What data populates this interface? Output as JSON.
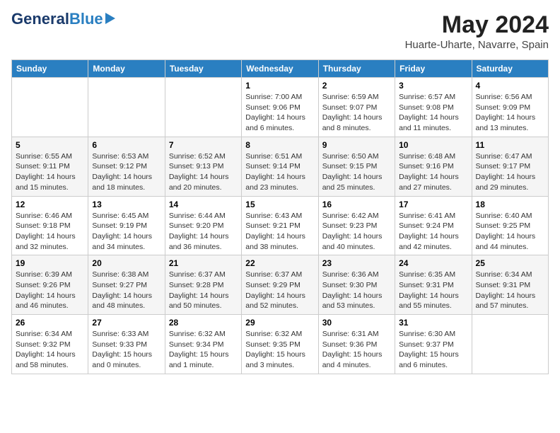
{
  "logo": {
    "general": "General",
    "blue": "Blue"
  },
  "title": {
    "month_year": "May 2024",
    "location": "Huarte-Uharte, Navarre, Spain"
  },
  "headers": [
    "Sunday",
    "Monday",
    "Tuesday",
    "Wednesday",
    "Thursday",
    "Friday",
    "Saturday"
  ],
  "weeks": [
    [
      {
        "day": "",
        "info": ""
      },
      {
        "day": "",
        "info": ""
      },
      {
        "day": "",
        "info": ""
      },
      {
        "day": "1",
        "info": "Sunrise: 7:00 AM\nSunset: 9:06 PM\nDaylight: 14 hours\nand 6 minutes."
      },
      {
        "day": "2",
        "info": "Sunrise: 6:59 AM\nSunset: 9:07 PM\nDaylight: 14 hours\nand 8 minutes."
      },
      {
        "day": "3",
        "info": "Sunrise: 6:57 AM\nSunset: 9:08 PM\nDaylight: 14 hours\nand 11 minutes."
      },
      {
        "day": "4",
        "info": "Sunrise: 6:56 AM\nSunset: 9:09 PM\nDaylight: 14 hours\nand 13 minutes."
      }
    ],
    [
      {
        "day": "5",
        "info": "Sunrise: 6:55 AM\nSunset: 9:11 PM\nDaylight: 14 hours\nand 15 minutes."
      },
      {
        "day": "6",
        "info": "Sunrise: 6:53 AM\nSunset: 9:12 PM\nDaylight: 14 hours\nand 18 minutes."
      },
      {
        "day": "7",
        "info": "Sunrise: 6:52 AM\nSunset: 9:13 PM\nDaylight: 14 hours\nand 20 minutes."
      },
      {
        "day": "8",
        "info": "Sunrise: 6:51 AM\nSunset: 9:14 PM\nDaylight: 14 hours\nand 23 minutes."
      },
      {
        "day": "9",
        "info": "Sunrise: 6:50 AM\nSunset: 9:15 PM\nDaylight: 14 hours\nand 25 minutes."
      },
      {
        "day": "10",
        "info": "Sunrise: 6:48 AM\nSunset: 9:16 PM\nDaylight: 14 hours\nand 27 minutes."
      },
      {
        "day": "11",
        "info": "Sunrise: 6:47 AM\nSunset: 9:17 PM\nDaylight: 14 hours\nand 29 minutes."
      }
    ],
    [
      {
        "day": "12",
        "info": "Sunrise: 6:46 AM\nSunset: 9:18 PM\nDaylight: 14 hours\nand 32 minutes."
      },
      {
        "day": "13",
        "info": "Sunrise: 6:45 AM\nSunset: 9:19 PM\nDaylight: 14 hours\nand 34 minutes."
      },
      {
        "day": "14",
        "info": "Sunrise: 6:44 AM\nSunset: 9:20 PM\nDaylight: 14 hours\nand 36 minutes."
      },
      {
        "day": "15",
        "info": "Sunrise: 6:43 AM\nSunset: 9:21 PM\nDaylight: 14 hours\nand 38 minutes."
      },
      {
        "day": "16",
        "info": "Sunrise: 6:42 AM\nSunset: 9:23 PM\nDaylight: 14 hours\nand 40 minutes."
      },
      {
        "day": "17",
        "info": "Sunrise: 6:41 AM\nSunset: 9:24 PM\nDaylight: 14 hours\nand 42 minutes."
      },
      {
        "day": "18",
        "info": "Sunrise: 6:40 AM\nSunset: 9:25 PM\nDaylight: 14 hours\nand 44 minutes."
      }
    ],
    [
      {
        "day": "19",
        "info": "Sunrise: 6:39 AM\nSunset: 9:26 PM\nDaylight: 14 hours\nand 46 minutes."
      },
      {
        "day": "20",
        "info": "Sunrise: 6:38 AM\nSunset: 9:27 PM\nDaylight: 14 hours\nand 48 minutes."
      },
      {
        "day": "21",
        "info": "Sunrise: 6:37 AM\nSunset: 9:28 PM\nDaylight: 14 hours\nand 50 minutes."
      },
      {
        "day": "22",
        "info": "Sunrise: 6:37 AM\nSunset: 9:29 PM\nDaylight: 14 hours\nand 52 minutes."
      },
      {
        "day": "23",
        "info": "Sunrise: 6:36 AM\nSunset: 9:30 PM\nDaylight: 14 hours\nand 53 minutes."
      },
      {
        "day": "24",
        "info": "Sunrise: 6:35 AM\nSunset: 9:31 PM\nDaylight: 14 hours\nand 55 minutes."
      },
      {
        "day": "25",
        "info": "Sunrise: 6:34 AM\nSunset: 9:31 PM\nDaylight: 14 hours\nand 57 minutes."
      }
    ],
    [
      {
        "day": "26",
        "info": "Sunrise: 6:34 AM\nSunset: 9:32 PM\nDaylight: 14 hours\nand 58 minutes."
      },
      {
        "day": "27",
        "info": "Sunrise: 6:33 AM\nSunset: 9:33 PM\nDaylight: 15 hours\nand 0 minutes."
      },
      {
        "day": "28",
        "info": "Sunrise: 6:32 AM\nSunset: 9:34 PM\nDaylight: 15 hours\nand 1 minute."
      },
      {
        "day": "29",
        "info": "Sunrise: 6:32 AM\nSunset: 9:35 PM\nDaylight: 15 hours\nand 3 minutes."
      },
      {
        "day": "30",
        "info": "Sunrise: 6:31 AM\nSunset: 9:36 PM\nDaylight: 15 hours\nand 4 minutes."
      },
      {
        "day": "31",
        "info": "Sunrise: 6:30 AM\nSunset: 9:37 PM\nDaylight: 15 hours\nand 6 minutes."
      },
      {
        "day": "",
        "info": ""
      }
    ]
  ]
}
